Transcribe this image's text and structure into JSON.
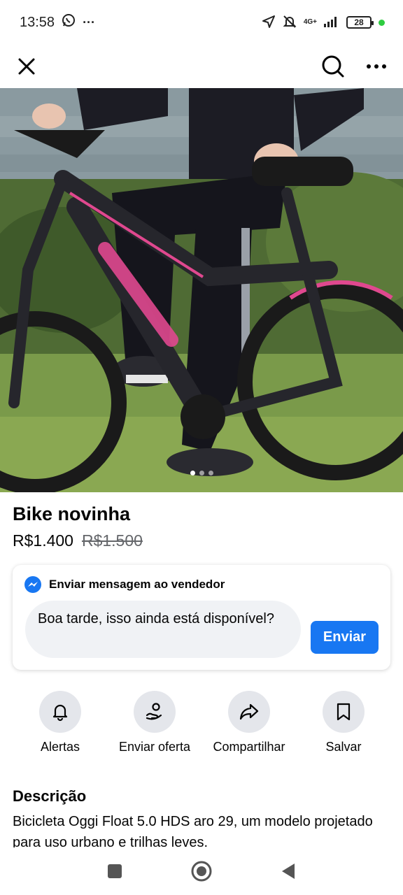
{
  "status_bar": {
    "time": "13:58",
    "dots": "···",
    "network": "4G+",
    "battery": "28"
  },
  "listing": {
    "title": "Bike novinha",
    "price": "R$1.400",
    "old_price": "R$1.500",
    "photo_count": 3,
    "photo_index": 1
  },
  "message_card": {
    "header": "Enviar mensagem ao vendedor",
    "input_value": "Boa tarde, isso ainda está disponível?",
    "send_label": "Enviar"
  },
  "actions": [
    {
      "label": "Alertas",
      "icon": "bell-icon"
    },
    {
      "label": "Enviar oferta",
      "icon": "offer-icon"
    },
    {
      "label": "Compartilhar",
      "icon": "share-icon"
    },
    {
      "label": "Salvar",
      "icon": "bookmark-icon"
    }
  ],
  "description": {
    "title": "Descrição",
    "text": "Bicicleta Oggi Float 5.0 HDS aro 29, um modelo projetado para uso urbano e trilhas leves."
  },
  "colors": {
    "accent": "#1877f2",
    "bike_pink": "#e0488f",
    "grey_circle": "#e4e6eb",
    "input_bg": "#f0f2f5"
  }
}
